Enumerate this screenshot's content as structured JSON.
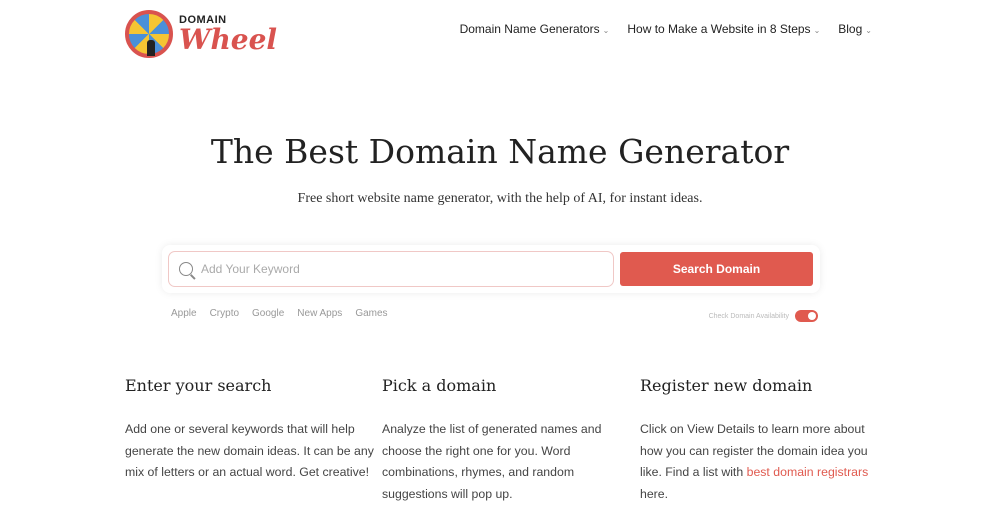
{
  "logo": {
    "line1": "DOMAIN",
    "line2": "Wheel"
  },
  "nav": [
    {
      "label": "Domain Name Generators"
    },
    {
      "label": "How to Make a Website in 8 Steps"
    },
    {
      "label": "Blog"
    }
  ],
  "hero": {
    "title": "The Best Domain Name Generator",
    "subtitle": "Free short website name generator, with the help of AI, for instant ideas."
  },
  "search": {
    "placeholder": "Add Your Keyword",
    "button": "Search Domain",
    "tags": [
      "Apple",
      "Crypto",
      "Google",
      "New Apps",
      "Games"
    ],
    "check_label": "Check Domain Availability",
    "check_on": true
  },
  "colors": {
    "accent": "#e05a4f"
  },
  "steps": [
    {
      "title": "Enter your search",
      "text": "Add one or several keywords that will help generate the new domain ideas. It can be any mix of letters or an actual word. Get creative!"
    },
    {
      "title": "Pick a domain",
      "text": "Analyze the list of generated names and choose the right one for you. Word combinations, rhymes, and random suggestions will pop up."
    },
    {
      "title": "Register new domain",
      "text_before": "Click on View Details to learn more about how you can register the domain idea you like. Find a list with ",
      "link": "best domain registrars",
      "text_after": " here."
    }
  ]
}
